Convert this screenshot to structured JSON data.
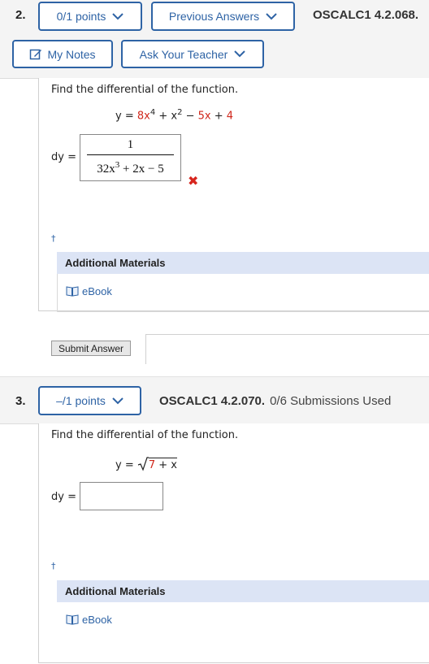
{
  "q2": {
    "number": "2.",
    "points_label": "0/1 points",
    "previous_label": "Previous Answers",
    "code": "OSCALC1 4.2.068.",
    "my_notes_label": "My Notes",
    "ask_teacher_label": "Ask Your Teacher",
    "prompt": "Find the differential of the function.",
    "eq": {
      "y_eq": "y = ",
      "c1": "8x",
      "e1": "4",
      "p1": " + ",
      "x2": "x",
      "e2": "2",
      "p2": " − ",
      "c3": "5x",
      "p3": " + ",
      "c4": "4"
    },
    "dy_label": "dy =",
    "answer": {
      "numerator": "1",
      "den_a": "32x",
      "den_exp": "3",
      "den_b": " + 2x − 5"
    },
    "dagger": "†",
    "additional_materials": "Additional Materials",
    "ebook": "eBook",
    "submit_label": "Submit Answer"
  },
  "q3": {
    "number": "3.",
    "points_label": "–/1 points",
    "code": "OSCALC1 4.2.070.",
    "submissions": "0/6 Submissions Used",
    "prompt": "Find the differential of the function.",
    "eq": {
      "y_eq": "y = ",
      "radicand_a": "7",
      "radicand_b": " + x"
    },
    "dy_label": "dy =",
    "dagger": "†",
    "additional_materials": "Additional Materials",
    "ebook": "eBook"
  },
  "colors": {
    "accent": "#2e63a5",
    "red": "#d0281c",
    "header_bg": "#f4f4f4",
    "am_bg": "#dce4f5"
  }
}
